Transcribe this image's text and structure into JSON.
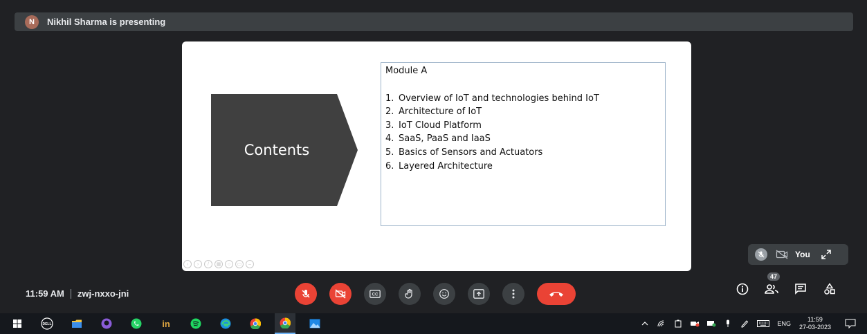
{
  "presenter": {
    "initial": "N",
    "banner_text": "Nikhil Sharma is presenting"
  },
  "slide": {
    "arrow_label": "Contents",
    "module_title": "Module A",
    "items": [
      {
        "num": "1.",
        "text": "Overview of IoT and technologies behind IoT"
      },
      {
        "num": "2.",
        "text": "Architecture of IoT"
      },
      {
        "num": "3.",
        "text": "IoT Cloud Platform"
      },
      {
        "num": "4.",
        "text": "SaaS, PaaS and IaaS"
      },
      {
        "num": "5.",
        "text": "Basics of Sensors and Actuators"
      },
      {
        "num": "6.",
        "text": "Layered Architecture"
      }
    ]
  },
  "self_tile": {
    "name": "You"
  },
  "meeting": {
    "time": "11:59 AM",
    "code": "zwj-nxxo-jni"
  },
  "controls": {
    "mic_icon": "mic-off-icon",
    "camera_icon": "camera-off-icon",
    "captions_label": "CC",
    "end_call_icon": "end-call-icon"
  },
  "right_controls": {
    "participant_count": "47"
  },
  "taskbar": {
    "language": "ENG",
    "clock_time": "11:59",
    "clock_date": "27-03-2023"
  },
  "colors": {
    "background": "#202124",
    "accent_red": "#ea4335",
    "button_gray": "#3c4043",
    "arrow_fill": "#404040"
  }
}
